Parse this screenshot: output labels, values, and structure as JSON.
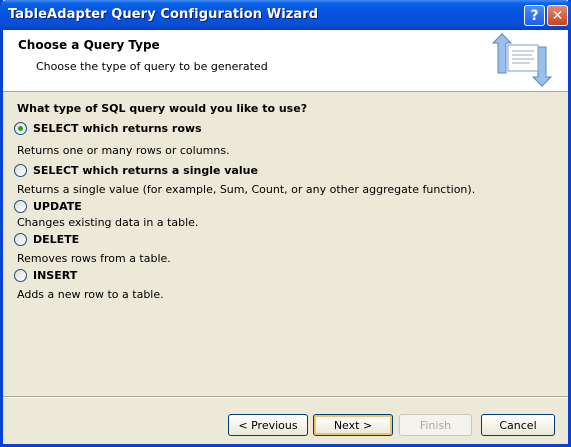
{
  "window": {
    "title": "TableAdapter Query Configuration Wizard",
    "help_glyph": "?",
    "close_glyph": "✕"
  },
  "header": {
    "title": "Choose a Query Type",
    "subtitle": "Choose the type of query to be generated",
    "icon": "query-wizard-icon"
  },
  "question": "What type of SQL query would you like to use?",
  "options": [
    {
      "label": "SELECT which returns rows",
      "description": "Returns one or many rows or columns.",
      "selected": true
    },
    {
      "label": "SELECT which returns a single value",
      "description": "Returns a single value (for example, Sum, Count, or any other aggregate function).",
      "selected": false
    },
    {
      "label": "UPDATE",
      "description": "Changes existing data in a table.",
      "selected": false
    },
    {
      "label": "DELETE",
      "description": "Removes rows from a table.",
      "selected": false
    },
    {
      "label": "INSERT",
      "description": "Adds a new row to a table.",
      "selected": false
    }
  ],
  "buttons": {
    "previous": "< Previous",
    "next": "Next >",
    "finish": "Finish",
    "cancel": "Cancel"
  },
  "colors": {
    "titlebar": "#0553e0",
    "radio_selected": "#21a121",
    "dialog_bg": "#ece9d8"
  }
}
